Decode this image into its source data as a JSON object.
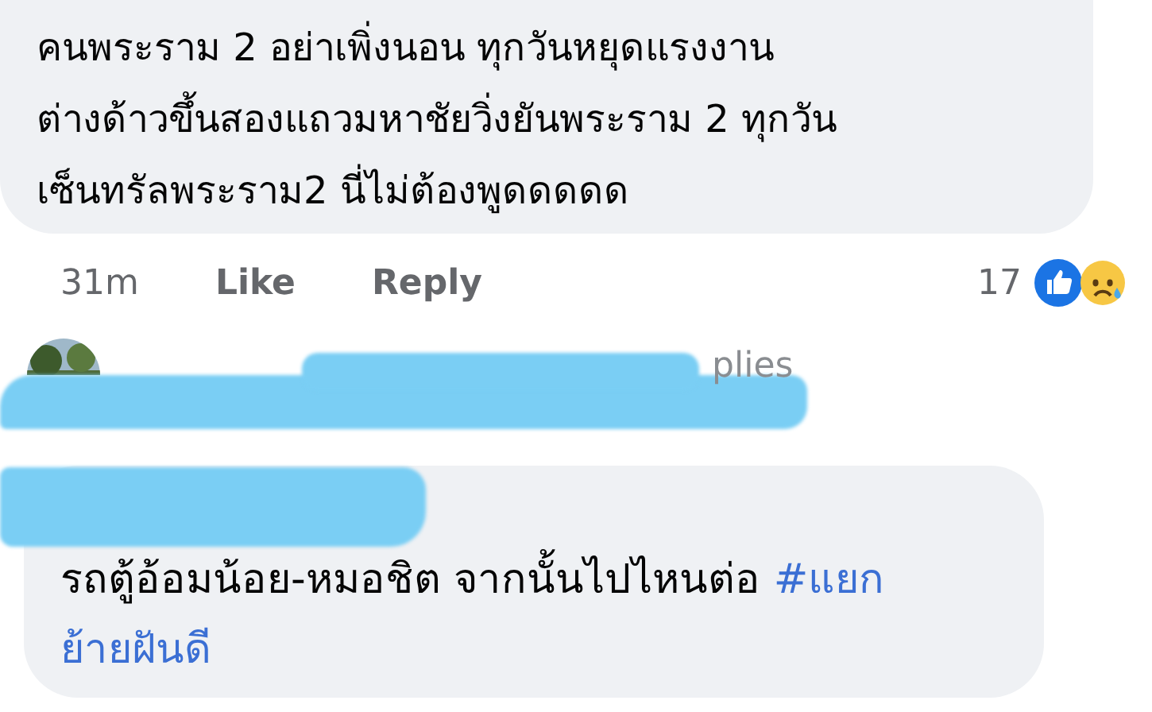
{
  "comments": [
    {
      "lines": [
        "คนพระราม 2 อย่าเพิ่งนอน ทุกวันหยุดแรงงาน",
        "ต่างด้าวขึ้นสองแถวมหาชัยวิ่งยันพระราม 2 ทุกวัน",
        "เซ็นทรัลพระราม2 นี่ไม่ต้องพูดดดดด"
      ],
      "time": "31m",
      "like": "Like",
      "reply": "Reply",
      "reaction_count": "17",
      "reactions": [
        {
          "kind": "like"
        },
        {
          "kind": "sad"
        }
      ]
    },
    {
      "replies_text": "plies"
    },
    {
      "text": "รถตู้อ้อมน้อย-หมอชิต จากนั้นไปไหนต่อ ",
      "hashtag_lines": [
        "#แยก",
        "ย้ายฝันดี"
      ]
    }
  ]
}
